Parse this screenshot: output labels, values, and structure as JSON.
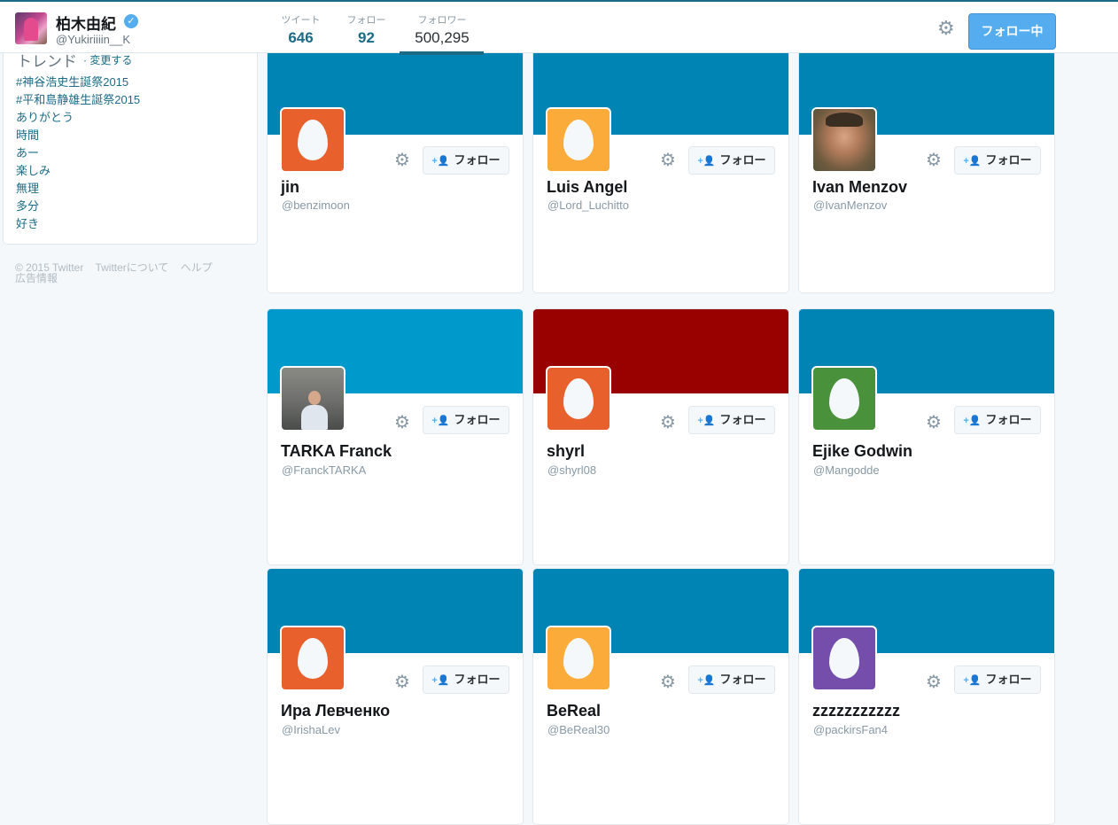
{
  "header": {
    "name": "柏木由紀",
    "handle": "@Yukiriiiin__K",
    "stats": [
      {
        "label": "ツイート",
        "value": "646"
      },
      {
        "label": "フォロー",
        "value": "92"
      },
      {
        "label": "フォロワー",
        "value": "500,295"
      }
    ],
    "following_label": "フォロー中"
  },
  "trends": {
    "title": "トレンド",
    "change_label": "· 変更する",
    "items": [
      "#神谷浩史生誕祭2015",
      "#平和島静雄生誕祭2015",
      "ありがとう",
      "時間",
      "あー",
      "楽しみ",
      "無理",
      "多分",
      "好き"
    ]
  },
  "footer": {
    "copyright": "© 2015 Twitter",
    "about": "Twitterについて",
    "help": "ヘルプ",
    "ads": "広告情報"
  },
  "follow_label": "フォロー",
  "cards": [
    {
      "name": "jin",
      "handle": "@benzimoon",
      "banner": "#0084b4",
      "avatar": "egg",
      "avatar_color": "#e8602c"
    },
    {
      "name": "Luis Angel",
      "handle": "@Lord_Luchitto",
      "banner": "#0084b4",
      "avatar": "egg",
      "avatar_color": "#fbab39"
    },
    {
      "name": "Ivan Menzov",
      "handle": "@IvanMenzov",
      "banner": "#0084b4",
      "avatar": "photo-man-portrait"
    },
    {
      "name": "TARKA Franck",
      "handle": "@FranckTARKA",
      "banner": "#0099cc",
      "avatar": "photo-man-standing"
    },
    {
      "name": "shyrl",
      "handle": "@shyrl08",
      "banner": "#990000",
      "avatar": "egg",
      "avatar_color": "#e8602c"
    },
    {
      "name": "Ejike Godwin",
      "handle": "@Mangodde",
      "banner": "#0084b4",
      "avatar": "egg",
      "avatar_color": "#4a913c"
    },
    {
      "name": "Ира Левченко",
      "handle": "@IrishaLev",
      "banner": "#0084b4",
      "avatar": "egg",
      "avatar_color": "#e8602c"
    },
    {
      "name": "BeReal",
      "handle": "@BeReal30",
      "banner": "#0084b4",
      "avatar": "egg",
      "avatar_color": "#fbab39"
    },
    {
      "name": "zzzzzzzzzzz",
      "handle": "@packirsFan4",
      "banner": "#0084b4",
      "avatar": "egg",
      "avatar_color": "#744eaa"
    }
  ]
}
